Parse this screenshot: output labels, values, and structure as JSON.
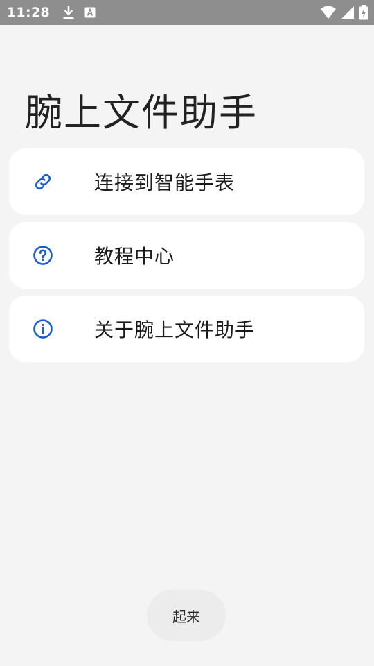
{
  "status_bar": {
    "time": "11:28",
    "left_icons": [
      "download-icon",
      "a-notification-icon"
    ],
    "right_icons": [
      "wifi-icon",
      "signal-icon",
      "battery-charging-icon"
    ]
  },
  "page": {
    "title": "腕上文件助手"
  },
  "menu": {
    "items": [
      {
        "label": "连接到智能手表",
        "icon": "link-icon"
      },
      {
        "label": "教程中心",
        "icon": "help-circle-icon"
      },
      {
        "label": "关于腕上文件助手",
        "icon": "info-circle-icon"
      }
    ]
  },
  "bottom_button": {
    "label": "起来"
  },
  "colors": {
    "accent": "#1a5fce",
    "background": "#f4f4f4",
    "card": "#ffffff",
    "status_bar": "#8e8e8e"
  }
}
